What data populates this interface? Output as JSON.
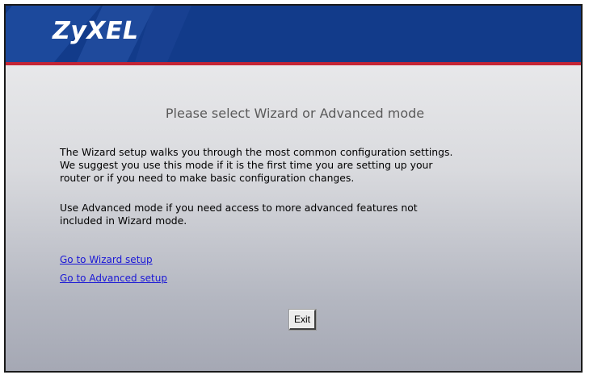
{
  "header": {
    "brand": "ZyXEL",
    "brand_color": "#123b8a",
    "accent_color": "#c42535"
  },
  "main": {
    "title": "Please select Wizard or Advanced mode",
    "paragraph1_lines": [
      "The Wizard setup walks you through the most common configuration settings.",
      "We suggest you use this mode if it is the first time you are setting up your",
      "router or if you need to make basic configuration changes."
    ],
    "paragraph2_lines": [
      "Use Advanced mode if you need access to more advanced features not",
      "included in Wizard mode."
    ],
    "links": {
      "wizard": "Go to Wizard setup",
      "advanced": "Go to Advanced setup"
    },
    "exit_label": "Exit"
  }
}
